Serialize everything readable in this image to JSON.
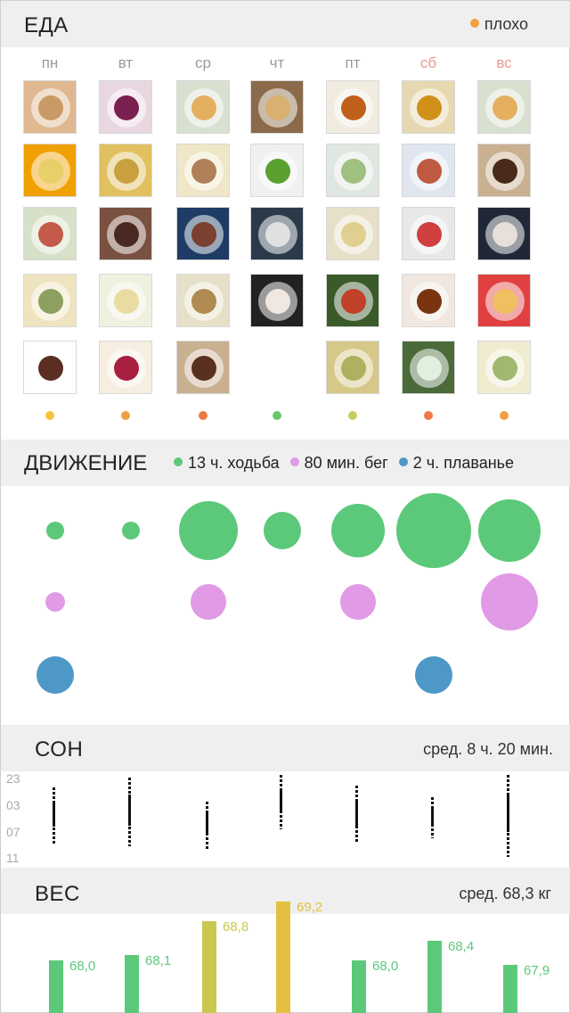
{
  "food": {
    "title": "ЕДА",
    "legend_label": "плохо",
    "legend_color": "#f0a040",
    "days": [
      "пн",
      "вт",
      "ср",
      "чт",
      "пт",
      "сб",
      "вс"
    ],
    "weekend_color": "#e69a8e",
    "columns": [
      {
        "meals": [
          [
            "#e0b890",
            "#c99a66"
          ],
          [
            "#f0a000",
            "#e8cf6a"
          ],
          [
            "#d7e0c8",
            "#c45a4a"
          ],
          [
            "#efe4c0",
            "#8da060"
          ],
          [
            "#ffffff",
            "#5a2e20"
          ]
        ],
        "dot": "#f3c63a"
      },
      {
        "meals": [
          [
            "#e8d7e0",
            "#7a2050"
          ],
          [
            "#e0c060",
            "#c8a040"
          ],
          [
            "#7a5040",
            "#4a2a20"
          ],
          [
            "#f0f0e0",
            "#e8dca0"
          ],
          [
            "#f6eee0",
            "#a82040"
          ]
        ],
        "dot": "#f0a040"
      },
      {
        "meals": [
          [
            "#d8e0d0",
            "#e4b060"
          ],
          [
            "#f0e6c8",
            "#b0805a"
          ],
          [
            "#1e3c66",
            "#7a4030"
          ],
          [
            "#e6e0c8",
            "#b08a50"
          ],
          [
            "#c8b090",
            "#5a3020"
          ]
        ],
        "dot": "#ee7a44"
      },
      {
        "meals": [
          [
            "#8a6a4a",
            "#d8b070"
          ],
          [
            "#f0f0f0",
            "#5aa02e"
          ],
          [
            "#2a3a4a",
            "#e0e0e0"
          ],
          [
            "#222222",
            "#f0e8e0"
          ],
          null
        ],
        "dot": "#6ac66a"
      },
      {
        "meals": [
          [
            "#f0ece0",
            "#c0601a"
          ],
          [
            "#e0e6e0",
            "#a0c080"
          ],
          [
            "#e6e0c8",
            "#e0d090"
          ],
          [
            "#3a5a2a",
            "#c0402a"
          ],
          [
            "#d6c888",
            "#b0b060"
          ]
        ],
        "dot": "#c8cc60"
      },
      {
        "meals": [
          [
            "#e6d8b0",
            "#d0901a"
          ],
          [
            "#e0e6f0",
            "#c05a40"
          ],
          [
            "#e8e8e8",
            "#d04040"
          ],
          [
            "#f0e8e0",
            "#7a3410"
          ],
          [
            "#4a6a3a",
            "#e0f0e0"
          ]
        ],
        "dot": "#ee7a44"
      },
      {
        "meals": [
          [
            "#d8e0d0",
            "#e4b060"
          ],
          [
            "#c8b090",
            "#4a2a1a"
          ],
          [
            "#202838",
            "#e8e0d8"
          ],
          [
            "#e04040",
            "#f0c060"
          ],
          [
            "#f0ecd0",
            "#a0b870"
          ]
        ],
        "dot": "#f0a040"
      }
    ]
  },
  "movement": {
    "title": "ДВИЖЕНИЕ",
    "legend": [
      {
        "label": "13 ч. ходьба",
        "color": "#5cc97a"
      },
      {
        "label": "80 мин. бег",
        "color": "#e19ae6"
      },
      {
        "label": "2 ч. плаванье",
        "color": "#4e98c8"
      }
    ],
    "walk": [
      1,
      1,
      3.3,
      2.1,
      3.0,
      4.2,
      3.5
    ],
    "run": [
      1,
      0,
      2.0,
      0,
      2.0,
      0,
      3.2
    ],
    "swim": [
      1,
      0,
      0,
      0,
      0,
      1,
      0
    ]
  },
  "sleep": {
    "title": "СОН",
    "average": "сред. 8 ч. 20 мин.",
    "ticks": [
      "23",
      "03",
      "07",
      "11"
    ],
    "nights": [
      {
        "start": 24.7,
        "end": 32.3
      },
      {
        "start": 23.4,
        "end": 32.6
      },
      {
        "start": 26.6,
        "end": 33.1
      },
      {
        "start": 23.0,
        "end": 30.4
      },
      {
        "start": 24.4,
        "end": 32.2
      },
      {
        "start": 26.0,
        "end": 31.6
      },
      {
        "start": 23.0,
        "end": 34.1
      }
    ]
  },
  "weight": {
    "title": "ВЕС",
    "average": "сред. 68,3 кг",
    "values": [
      {
        "v": 68.0,
        "label": "68,0",
        "color": "#5cc97a"
      },
      {
        "v": 68.1,
        "label": "68,1",
        "color": "#5cc97a"
      },
      {
        "v": 68.8,
        "label": "68,8",
        "color": "#c8c850"
      },
      {
        "v": 69.2,
        "label": "69,2",
        "color": "#e4c040"
      },
      {
        "v": 68.0,
        "label": "68,0",
        "color": "#5cc97a"
      },
      {
        "v": 68.4,
        "label": "68,4",
        "color": "#5cc97a"
      },
      {
        "v": 67.9,
        "label": "67,9",
        "color": "#5cc97a"
      }
    ]
  }
}
